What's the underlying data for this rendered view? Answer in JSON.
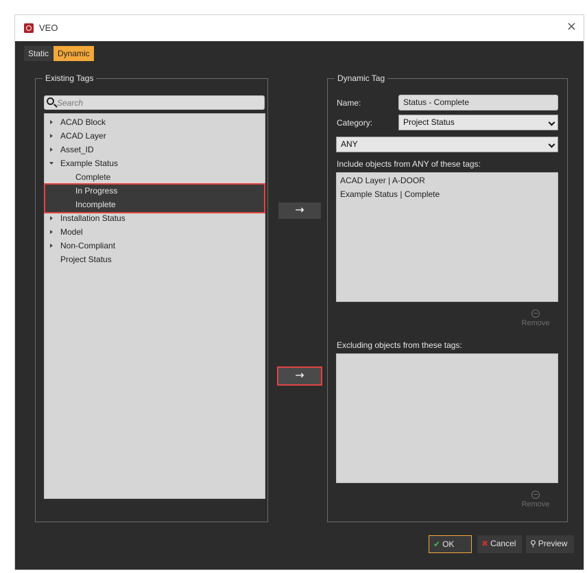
{
  "window": {
    "title": "VEO",
    "close_glyph": "×"
  },
  "tabs": [
    {
      "label": "Static",
      "active": false
    },
    {
      "label": "Dynamic",
      "active": true
    }
  ],
  "existing_tags": {
    "title": "Existing Tags",
    "search_placeholder": "Search",
    "items": [
      {
        "label": "ACAD Block",
        "expanded": false,
        "level": 0
      },
      {
        "label": "ACAD Layer",
        "expanded": false,
        "level": 0
      },
      {
        "label": "Asset_ID",
        "expanded": false,
        "level": 0
      },
      {
        "label": "Example Status",
        "expanded": true,
        "level": 0
      },
      {
        "label": "Complete",
        "level": 1
      },
      {
        "label": "In Progress",
        "level": 1,
        "selected": true
      },
      {
        "label": "Incomplete",
        "level": 1,
        "selected": true
      },
      {
        "label": "Installation Status",
        "expanded": false,
        "level": 0
      },
      {
        "label": "Model",
        "expanded": false,
        "level": 0
      },
      {
        "label": "Non-Compliant",
        "expanded": false,
        "level": 0
      },
      {
        "label": "Project Status",
        "level": 0
      }
    ]
  },
  "arrow_glyph": "→",
  "dynamic_tag": {
    "title": "Dynamic Tag",
    "name_label": "Name:",
    "name_value": "Status - Complete",
    "category_label": "Category:",
    "category_value": "Project Status",
    "match_value": "ANY",
    "include_label": "Include objects from ANY of these tags:",
    "include_items": [
      "ACAD Layer | A-DOOR",
      "Example Status | Complete"
    ],
    "exclude_label": "Excluding objects from these tags:",
    "exclude_items": [],
    "remove_label": "Remove"
  },
  "buttons": {
    "ok": "OK",
    "cancel": "Cancel",
    "preview": "Preview"
  },
  "colors": {
    "accent": "#f2a83b",
    "highlight_border": "#e04444",
    "background": "#2c2c2c"
  }
}
